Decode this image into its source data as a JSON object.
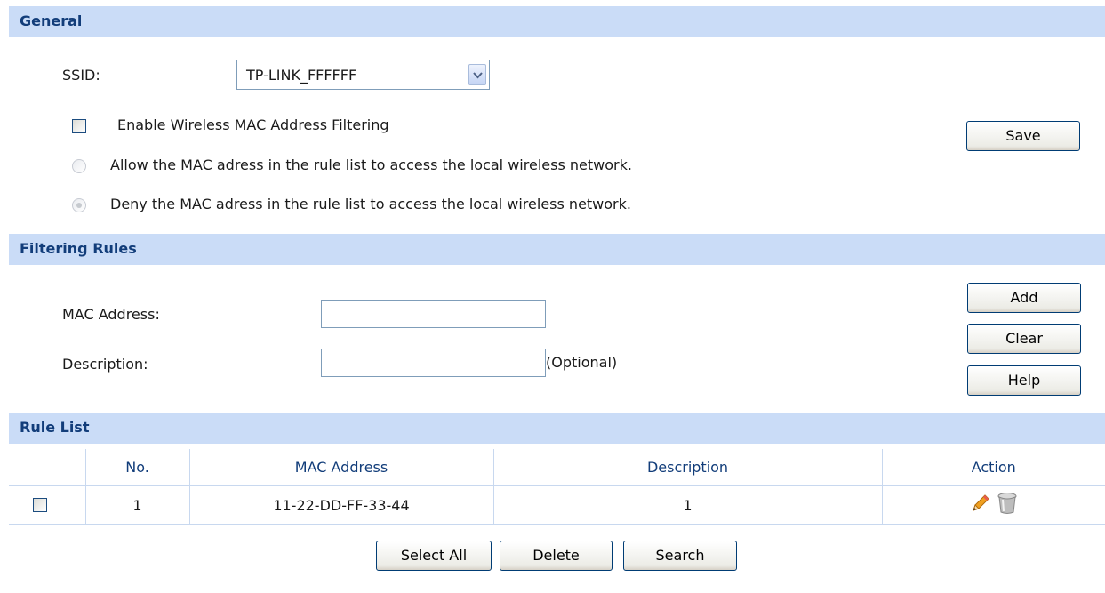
{
  "general": {
    "title": "General",
    "ssid_label": "SSID:",
    "ssid_value": "TP-LINK_FFFFFF",
    "enable_label": "Enable Wireless MAC Address Filtering",
    "allow_label": "Allow the MAC adress in the rule list to access the local wireless network.",
    "deny_label": "Deny the MAC adress in the rule list to access the local wireless network.",
    "save_label": "Save",
    "enable_checked": false,
    "selected_mode": "deny"
  },
  "filtering": {
    "title": "Filtering Rules",
    "mac_label": "MAC Address:",
    "mac_value": "",
    "desc_label": "Description:",
    "desc_value": "",
    "optional_text": "(Optional)",
    "add_label": "Add",
    "clear_label": "Clear",
    "help_label": "Help"
  },
  "rule_list": {
    "title": "Rule List",
    "columns": [
      "",
      "No.",
      "MAC Address",
      "Description",
      "Action"
    ],
    "rows": [
      {
        "no": "1",
        "mac": "11-22-DD-FF-33-44",
        "description": "1",
        "checked": false,
        "action_icons": [
          "edit-pencil-icon",
          "delete-trash-icon"
        ]
      }
    ],
    "select_all_label": "Select All",
    "delete_label": "Delete",
    "search_label": "Search"
  },
  "colors": {
    "section_bar": "#cadcf7",
    "section_title": "#123d7a",
    "button_border": "#003c74"
  }
}
